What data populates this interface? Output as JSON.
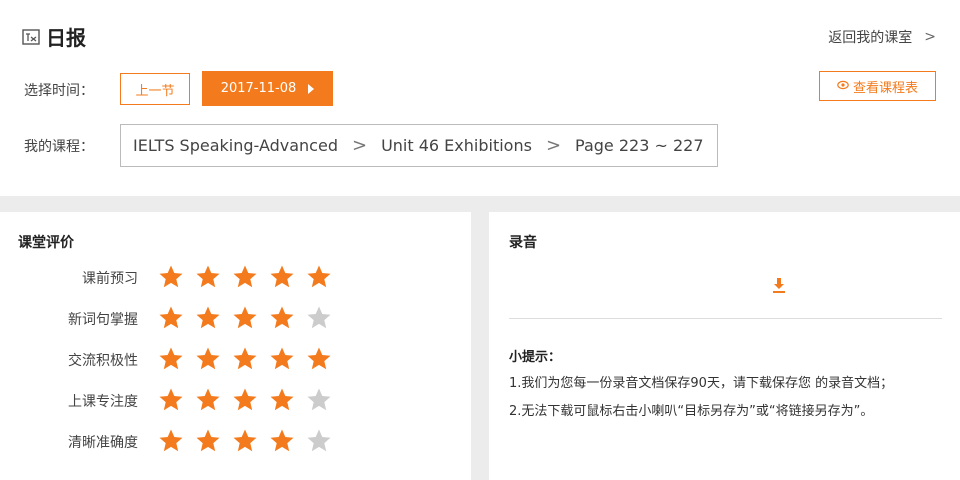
{
  "header": {
    "icon": "report-icon",
    "title": "日报",
    "back_link": "返回我的课室",
    "back_chevron": ">"
  },
  "time_select": {
    "label": "选择时间：",
    "prev_button": "上一节",
    "date": "2017-11-08",
    "schedule_button": "查看课程表"
  },
  "course": {
    "label": "我的课程：",
    "course_name": "IELTS Speaking-Advanced",
    "unit": "Unit 46 Exhibitions",
    "pages": "Page 223 ~ 227",
    "separator": ">"
  },
  "evaluation": {
    "title": "课堂评价",
    "max_stars": 5,
    "items": [
      {
        "label": "课前预习",
        "stars": 5
      },
      {
        "label": "新词句掌握",
        "stars": 4
      },
      {
        "label": "交流积极性",
        "stars": 5
      },
      {
        "label": "上课专注度",
        "stars": 4
      },
      {
        "label": "清晰准确度",
        "stars": 4
      }
    ]
  },
  "recording": {
    "title": "录音",
    "download_icon": "download-icon",
    "tip_title": "小提示：",
    "tips": [
      "1.我们为您每一份录音文档保存90天，请下载保存您 的录音文档；",
      "2.无法下载可鼠标右击小喇叭“目标另存为”或“将链接另存为”。"
    ]
  },
  "colors": {
    "accent": "#f37b1d",
    "star_on": "#f37b1d",
    "star_off": "#cccccc"
  }
}
